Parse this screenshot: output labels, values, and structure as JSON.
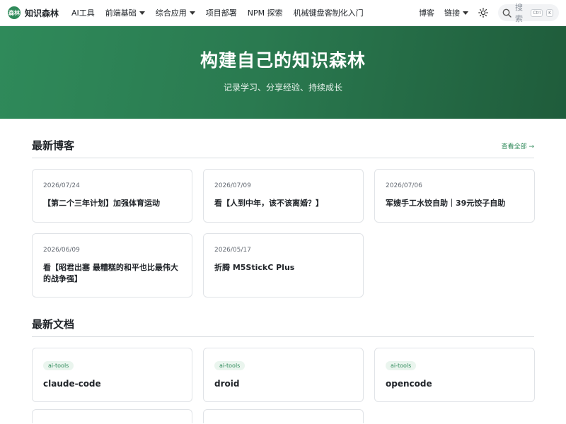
{
  "nav": {
    "logo_mark": "森林",
    "logo_text": "知识森林",
    "links": [
      {
        "label": "AI工具",
        "dropdown": false
      },
      {
        "label": "前端基础",
        "dropdown": true
      },
      {
        "label": "综合应用",
        "dropdown": true
      },
      {
        "label": "项目部署",
        "dropdown": false
      },
      {
        "label": "NPM 探索",
        "dropdown": false
      },
      {
        "label": "机械键盘客制化入门",
        "dropdown": false
      }
    ],
    "blog": "博客",
    "links_menu": "链接",
    "search_placeholder": "搜索",
    "kbd_ctrl": "Ctrl",
    "kbd_k": "K"
  },
  "hero": {
    "title": "构建自己的知识森林",
    "subtitle": "记录学习、分享经验、持续成长"
  },
  "blogs": {
    "title": "最新博客",
    "see_all": "查看全部 →",
    "items": [
      {
        "date": "2026/07/24",
        "title": "【第二个三年计划】加强体育运动"
      },
      {
        "date": "2026/07/09",
        "title": "看【人到中年，该不该离婚？】"
      },
      {
        "date": "2026/07/06",
        "title": "军嫂手工水饺自助｜39元饺子自助"
      },
      {
        "date": "2026/06/09",
        "title": "看【昭君出塞 最糟糕的和平也比最伟大的战争强】"
      },
      {
        "date": "2026/05/17",
        "title": "折腾 M5StickC Plus"
      }
    ]
  },
  "docs": {
    "title": "最新文档",
    "items": [
      {
        "tag": "ai-tools",
        "title": "claude-code"
      },
      {
        "tag": "ai-tools",
        "title": "droid"
      },
      {
        "tag": "ai-tools",
        "title": "opencode"
      }
    ]
  },
  "colors": {
    "accent": "#2f8a5a",
    "hero_start": "#2f8a5a",
    "hero_end": "#1f5c3b"
  }
}
